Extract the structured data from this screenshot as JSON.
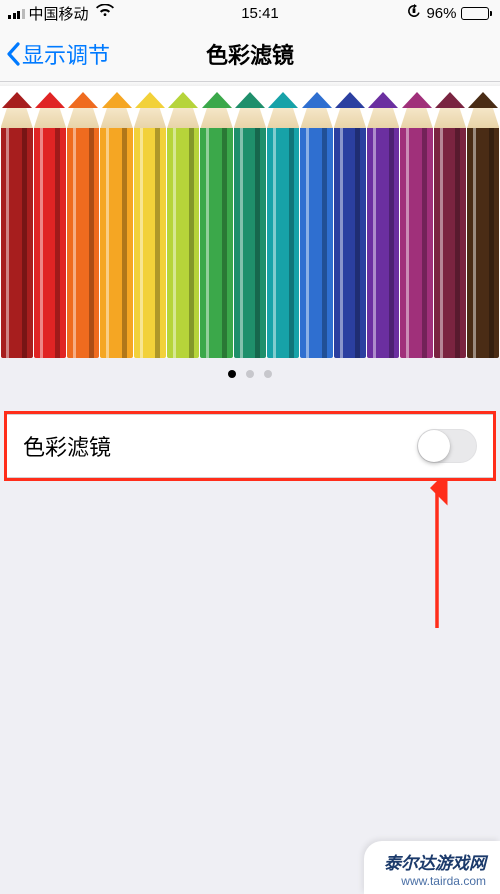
{
  "statusBar": {
    "carrier": "中国移动",
    "time": "15:41",
    "batteryPct": "96%"
  },
  "nav": {
    "back": "显示调节",
    "title": "色彩滤镜"
  },
  "pencilColors": [
    "#a71e1e",
    "#e02424",
    "#ef6b1f",
    "#f5a623",
    "#f2d13a",
    "#b6d43a",
    "#3ba84a",
    "#1f8f6b",
    "#17a2a8",
    "#2f6fd0",
    "#2b3fa0",
    "#6b2fa0",
    "#a0307a",
    "#7a2440",
    "#4a2c15"
  ],
  "pagination": {
    "count": 3,
    "activeIndex": 0
  },
  "settings": {
    "colorFilter": {
      "label": "色彩滤镜",
      "on": false
    }
  },
  "watermark": {
    "title": "泰尔达游戏网",
    "url": "www.tairda.com"
  }
}
